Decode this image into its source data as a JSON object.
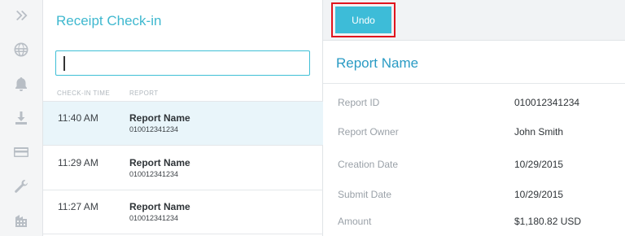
{
  "sidebar": {
    "icons": [
      "expand-icon",
      "globe-icon",
      "bell-icon",
      "download-icon",
      "credit-card-icon",
      "wrench-icon",
      "building-icon"
    ]
  },
  "checkin": {
    "title": "Receipt Check-in",
    "search_value": "",
    "columns": {
      "time": "CHECK-IN TIME",
      "report": "REPORT"
    },
    "rows": [
      {
        "time": "11:40 AM",
        "name": "Report Name",
        "id": "010012341234",
        "selected": true
      },
      {
        "time": "11:29 AM",
        "name": "Report Name",
        "id": "010012341234",
        "selected": false
      },
      {
        "time": "11:27 AM",
        "name": "Report Name",
        "id": "010012341234",
        "selected": false
      }
    ]
  },
  "detail": {
    "undo_label": "Undo",
    "title": "Report Name",
    "fields": [
      {
        "label": "Report ID",
        "value": "010012341234"
      },
      {
        "label": "Report Owner",
        "value": "John Smith"
      },
      {
        "label": "Creation Date",
        "value": "10/29/2015"
      },
      {
        "label": "Submit Date",
        "value": "10/29/2015"
      },
      {
        "label": "Amount",
        "value": "$1,180.82 USD"
      }
    ]
  },
  "colors": {
    "accent": "#3dbcd8",
    "title_blue": "#2a9bc4",
    "highlight_border": "#e0141e",
    "selected_row": "#e9f5fa"
  }
}
